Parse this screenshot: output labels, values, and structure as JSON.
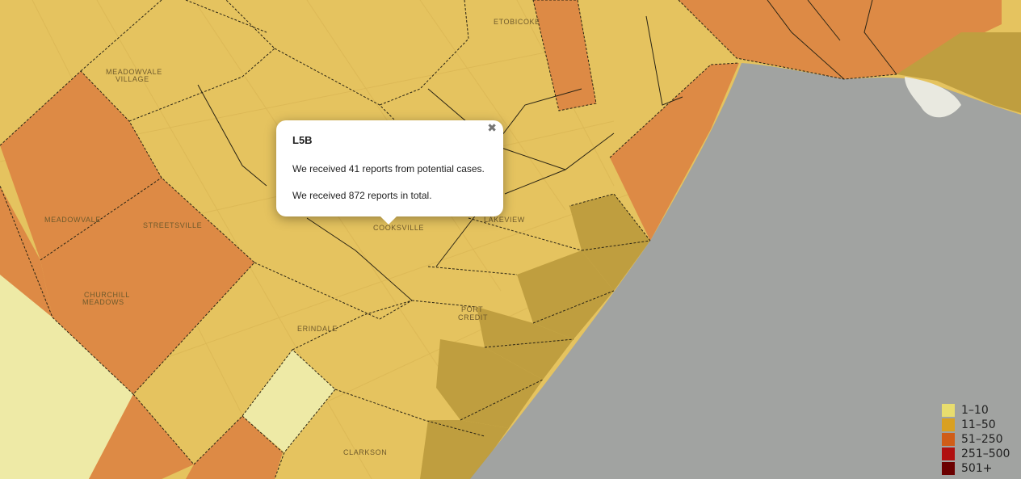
{
  "popup": {
    "title": "L5B",
    "line1": "We received 41 reports from potential cases.",
    "line2": "We received 872 reports in total.",
    "close_icon": "close-icon"
  },
  "places": {
    "etobicoke": "ETOBICOKE",
    "meadowvale_village_1": "MEADOWVALE",
    "meadowvale_village_2": "VILLAGE",
    "meadowvale": "MEADOWVALE",
    "streetsville": "STREETSVILLE",
    "churchill_1": "CHURCHILL",
    "churchill_2": "MEADOWS",
    "cooksville": "COOKSVILLE",
    "lakeview": "LAKEVIEW",
    "port_credit_1": "PORT",
    "port_credit_2": "CREDIT",
    "erindale": "ERINDALE",
    "clarkson": "CLARKSON"
  },
  "legend": {
    "items": [
      {
        "label": "1–10",
        "color": "#e8dd6e"
      },
      {
        "label": "11–50",
        "color": "#d9a021"
      },
      {
        "label": "51–250",
        "color": "#d05d18"
      },
      {
        "label": "251–500",
        "color": "#b01010"
      },
      {
        "label": "501+",
        "color": "#6b0000"
      }
    ]
  },
  "colors": {
    "lake": "#a1a3a1",
    "light_yellow": "#eeeaa6",
    "yellow": "#e5c35f",
    "dark_yellow": "#bf9e3f",
    "orange": "#dd8a45"
  }
}
